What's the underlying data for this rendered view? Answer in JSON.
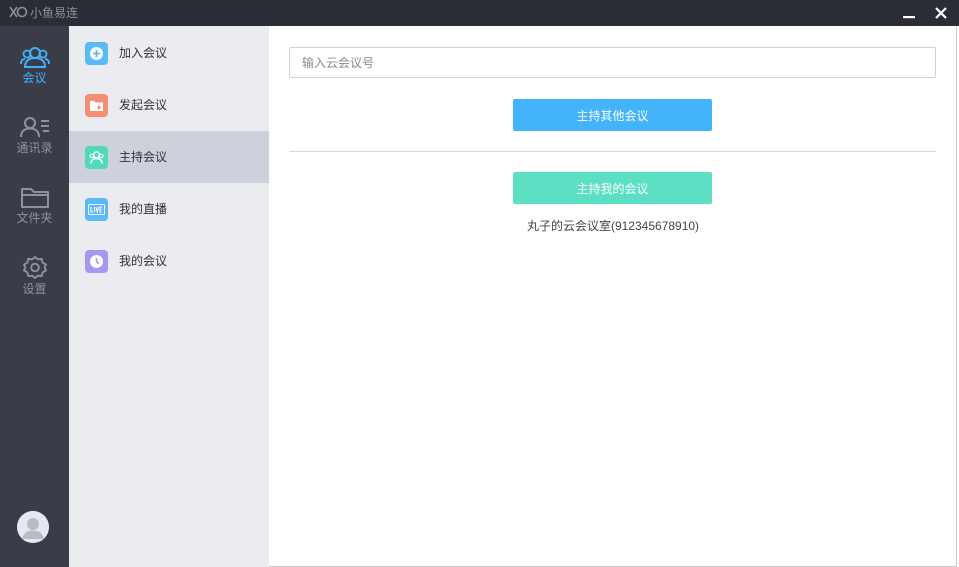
{
  "window": {
    "title": "小鱼易连",
    "minimize_icon": "minimize-icon",
    "close_icon": "close-icon"
  },
  "rail": {
    "items": [
      {
        "label": "会议",
        "icon": "meeting-people-icon",
        "active": true
      },
      {
        "label": "通讯录",
        "icon": "contacts-icon",
        "active": false
      },
      {
        "label": "文件夹",
        "icon": "folder-icon",
        "active": false
      },
      {
        "label": "设置",
        "icon": "gear-icon",
        "active": false
      }
    ],
    "avatar_icon": "user-avatar-icon"
  },
  "submenu": {
    "items": [
      {
        "label": "加入会议",
        "icon": "plus-circle-icon",
        "color": "#5ab9f7",
        "active": false
      },
      {
        "label": "发起会议",
        "icon": "start-meeting-icon",
        "color": "#f58e75",
        "active": false
      },
      {
        "label": "主持会议",
        "icon": "host-people-icon",
        "color": "#52d9b8",
        "active": true
      },
      {
        "label": "我的直播",
        "icon": "live-icon",
        "color": "#5ab9f7",
        "active": false
      },
      {
        "label": "我的会议",
        "icon": "clock-icon",
        "color": "#a796f2",
        "active": false
      }
    ]
  },
  "main": {
    "input_placeholder": "输入云会议号",
    "input_value": "",
    "host_other_button": "主持其他会议",
    "host_mine_button": "主持我的会议",
    "room_name": "丸子的云会议室(912345678910)"
  },
  "colors": {
    "accent_blue": "#43b3fb",
    "accent_green": "#5cdfc3",
    "rail_bg": "#3a3c47",
    "titlebar_bg": "#2b2d36",
    "submenu_bg": "#ebecf0",
    "submenu_active_bg": "#cdd1dc"
  }
}
